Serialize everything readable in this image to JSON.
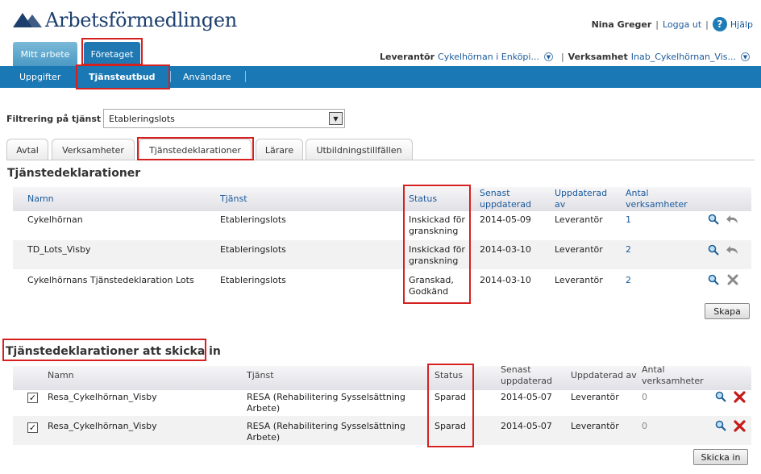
{
  "app": {
    "logo_text": "Arbetsförmedlingen"
  },
  "header": {
    "user_name": "Nina Greger",
    "logout_label": "Logga ut",
    "help_label": "Hjälp",
    "provider_label": "Leverantör",
    "provider_value": "Cykelhörnan i Enköpi...",
    "operation_label": "Verksamhet",
    "operation_value": "Inab_Cykelhörnan_Vis..."
  },
  "main_tabs": [
    {
      "label": "Mitt arbete"
    },
    {
      "label": "Företaget"
    }
  ],
  "nav": [
    {
      "label": "Uppgifter"
    },
    {
      "label": "Tjänsteutbud"
    },
    {
      "label": "Användare"
    }
  ],
  "filter": {
    "label": "Filtrering på tjänst",
    "value": "Etableringslots"
  },
  "sub_tabs": [
    {
      "label": "Avtal"
    },
    {
      "label": "Verksamheter"
    },
    {
      "label": "Tjänstedeklarationer"
    },
    {
      "label": "Lärare"
    },
    {
      "label": "Utbildningstillfällen"
    }
  ],
  "declarations": {
    "title": "Tjänstedeklarationer",
    "columns": {
      "name": "Namn",
      "service": "Tjänst",
      "status": "Status",
      "updated_1": "Senast",
      "updated_2": "uppdaterad",
      "updated_by_1": "Uppdaterad",
      "updated_by_2": "av",
      "count_1": "Antal",
      "count_2": "verksamheter"
    },
    "rows": [
      {
        "name": "Cykelhörnan",
        "service": "Etableringslots",
        "status_1": "Inskickad för",
        "status_2": "granskning",
        "date": "2014-05-09",
        "by": "Leverantör",
        "count": "1"
      },
      {
        "name": "TD_Lots_Visby",
        "service": "Etableringslots",
        "status_1": "Inskickad för",
        "status_2": "granskning",
        "date": "2014-03-10",
        "by": "Leverantör",
        "count": "2"
      },
      {
        "name": "Cykelhörnans Tjänstedeklaration Lots",
        "service": "Etableringslots",
        "status_1": "Granskad,",
        "status_2": "Godkänd",
        "date": "2014-03-10",
        "by": "Leverantör",
        "count": "2"
      }
    ],
    "create_button": "Skapa"
  },
  "to_send": {
    "title": "Tjänstedeklarationer att skicka in",
    "columns": {
      "name": "Namn",
      "service": "Tjänst",
      "status": "Status",
      "updated_1": "Senast",
      "updated_2": "uppdaterad",
      "updated_by": "Uppdaterad av",
      "count_1": "Antal",
      "count_2": "verksamheter"
    },
    "rows": [
      {
        "checked": "✓",
        "name": "Resa_Cykelhörnan_Visby",
        "service_1": "RESA (Rehabilitering Sysselsättning",
        "service_2": "Arbete)",
        "status": "Sparad",
        "date": "2014-05-07",
        "by": "Leverantör",
        "count": "0"
      },
      {
        "checked": "✓",
        "name": "Resa_Cykelhörnan_Visby",
        "service_1": "RESA (Rehabilitering Sysselsättning",
        "service_2": "Arbete)",
        "status": "Sparad",
        "date": "2014-05-07",
        "by": "Leverantör",
        "count": "0"
      }
    ],
    "send_button": "Skicka in"
  },
  "colors": {
    "nav_blue": "#1a78b4",
    "link_blue": "#1a5a9c",
    "highlight_red": "#d62020",
    "delete_red": "#c41c1c"
  }
}
